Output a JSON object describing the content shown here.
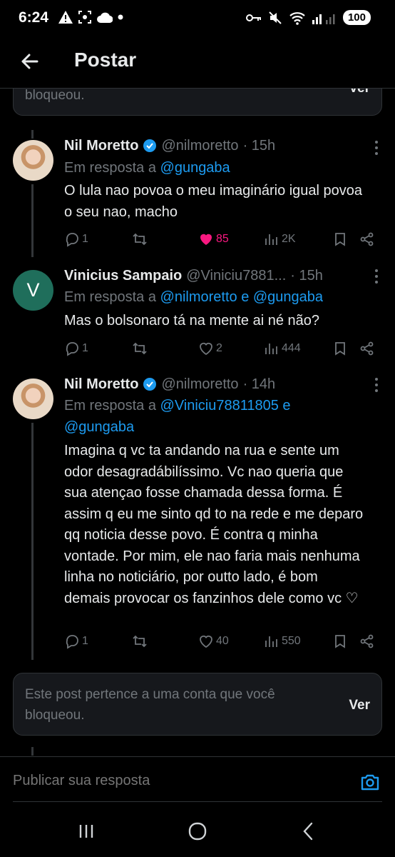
{
  "status_bar": {
    "time": "6:24",
    "battery": "100",
    "icons": [
      "warning-icon",
      "screenshot-icon",
      "cloud-icon",
      "dot-icon",
      "key-icon",
      "mute-icon",
      "wifi-icon",
      "signal-icon"
    ]
  },
  "header": {
    "title": "Postar",
    "back_icon": "arrow-left-icon"
  },
  "blocked_top": {
    "text": "bloqueou.",
    "button": "Ver"
  },
  "tweets": [
    {
      "name": "Nil Moretto",
      "handle": "@nilmoretto",
      "time": "· 15h",
      "verified": true,
      "reply_prefix": "Em resposta a",
      "reply_mentions": "@gungaba",
      "body": "O lula nao povoa o meu imaginário igual povoa o seu nao, macho",
      "replies": "1",
      "reposts": "",
      "likes": "85",
      "views": "2K",
      "liked": true
    },
    {
      "name": "Vinicius Sampaio",
      "handle": "@Viniciu7881...",
      "time": "· 15h",
      "avatar_letter": "V",
      "reply_prefix": "Em resposta a",
      "reply_mentions": "@nilmoretto e @gungaba",
      "body": "Mas o bolsonaro tá na mente ai né não?",
      "replies": "1",
      "reposts": "",
      "likes": "2",
      "views": "444"
    },
    {
      "name": "Nil Moretto",
      "handle": "@nilmoretto",
      "time": "· 14h",
      "verified": true,
      "reply_prefix": "Em resposta a",
      "reply_mentions": "@Viniciu78811805 e @gungaba",
      "body": "Imagina q vc ta andando na rua e sente um odor desagradábilíssimo. Vc nao queria que sua atençao fosse chamada dessa forma. É assim q eu me sinto qd to na rede e me deparo qq noticia desse povo. É contra q minha vontade. Por mim, ele nao faria mais nenhuma linha no noticiário, por outto lado, é bom demais provocar os fanzinhos dele como vc ♡",
      "replies": "1",
      "reposts": "",
      "likes": "40",
      "views": "550"
    }
  ],
  "blocked_bottom": {
    "text": "Este post pertence a uma conta que você bloqueou.",
    "button": "Ver"
  },
  "reply_bar": {
    "placeholder": "Publicar sua resposta"
  },
  "colors": {
    "accent": "#1d9bf0",
    "like": "#f91880",
    "muted": "#71767b",
    "background": "#000000"
  }
}
